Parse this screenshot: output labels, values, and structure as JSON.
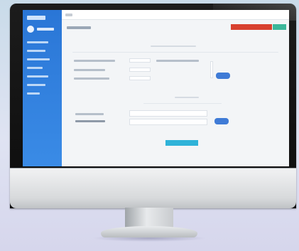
{
  "scene": {
    "description_kind": "photo-of-monitor",
    "colors": {
      "background": "#d6e0ee",
      "sidebar": "#2f80de",
      "primary_action": "#d8412f",
      "secondary_action": "#3cb79a",
      "submit_action": "#2fb3d9",
      "chip": "#3f7bd6"
    }
  },
  "icons": [
    "user-avatar-icon"
  ]
}
